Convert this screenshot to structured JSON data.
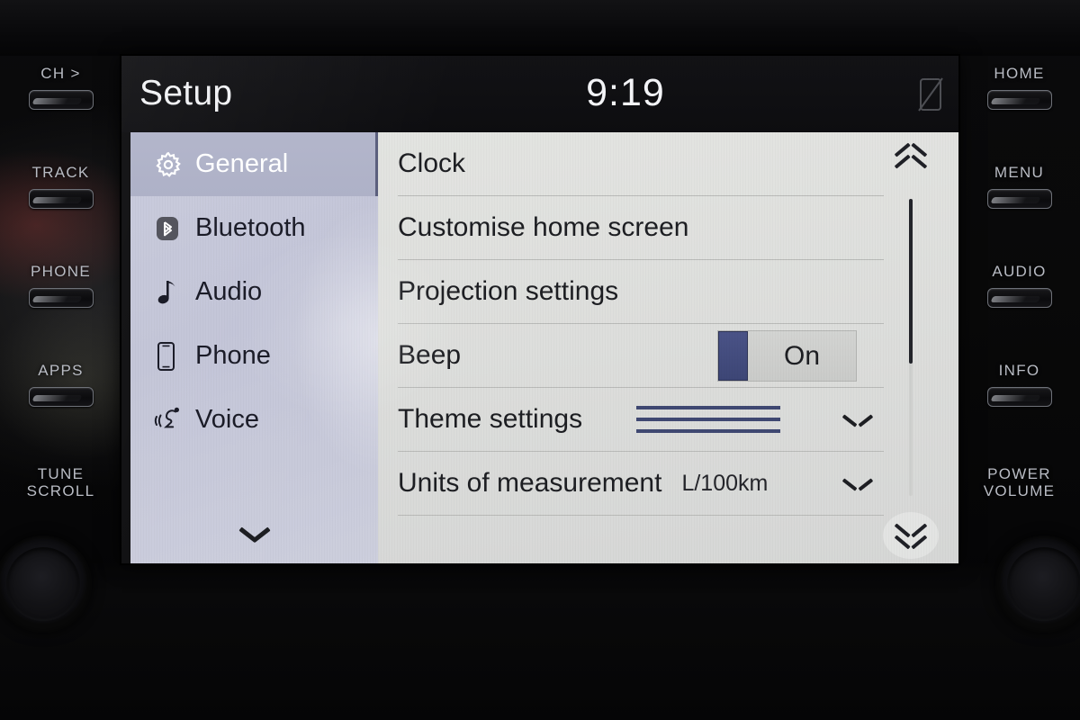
{
  "screen": {
    "title": "Setup",
    "clock": "9:19",
    "status_icon": "no-signal-icon"
  },
  "sidebar": {
    "items": [
      {
        "label": "General",
        "icon": "gear-icon",
        "selected": true
      },
      {
        "label": "Bluetooth",
        "icon": "bluetooth-icon",
        "selected": false
      },
      {
        "label": "Audio",
        "icon": "music-note-icon",
        "selected": false
      },
      {
        "label": "Phone",
        "icon": "phone-icon",
        "selected": false
      },
      {
        "label": "Voice",
        "icon": "voice-icon",
        "selected": false
      }
    ],
    "more_icon": "chevron-down-icon"
  },
  "list": {
    "rows": [
      {
        "label": "Clock",
        "value": "",
        "control": "none"
      },
      {
        "label": "Customise home screen",
        "value": "",
        "control": "none"
      },
      {
        "label": "Projection settings",
        "value": "",
        "control": "none"
      },
      {
        "label": "Beep",
        "value": "On",
        "control": "toggle"
      },
      {
        "label": "Theme settings",
        "value": "",
        "control": "swatch-chevron"
      },
      {
        "label": "Units of measurement",
        "value": "L/100km",
        "control": "chevron"
      }
    ]
  },
  "scrollbar": {
    "up_icon": "double-chevron-up-icon",
    "down_icon": "double-chevron-down-icon",
    "thumb_position_percent": 0,
    "thumb_size_percent": 55
  },
  "bezel": {
    "left_buttons": [
      {
        "label": "CH >",
        "lines": [
          "CH >"
        ]
      },
      {
        "label": "TRACK",
        "lines": [
          "TRACK"
        ]
      },
      {
        "label": "PHONE",
        "lines": [
          "PHONE"
        ]
      },
      {
        "label": "APPS",
        "lines": [
          "APPS"
        ]
      }
    ],
    "left_knob_label": {
      "lines": [
        "TUNE",
        "SCROLL"
      ]
    },
    "right_buttons": [
      {
        "label": "HOME",
        "lines": [
          "HOME"
        ]
      },
      {
        "label": "MENU",
        "lines": [
          "MENU"
        ]
      },
      {
        "label": "AUDIO",
        "lines": [
          "AUDIO"
        ]
      },
      {
        "label": "INFO",
        "lines": [
          "INFO"
        ]
      }
    ],
    "right_knob_label": {
      "lines": [
        "POWER",
        "VOLUME"
      ]
    }
  },
  "colors": {
    "accent_blue": "#3f4872",
    "sidebar_bg": "#c3c5d8",
    "sidebar_selected": "#b0b3c9",
    "panel_bg": "#dedfdc",
    "text_dark": "#1d1e22",
    "text_light": "#f2f3f6"
  }
}
